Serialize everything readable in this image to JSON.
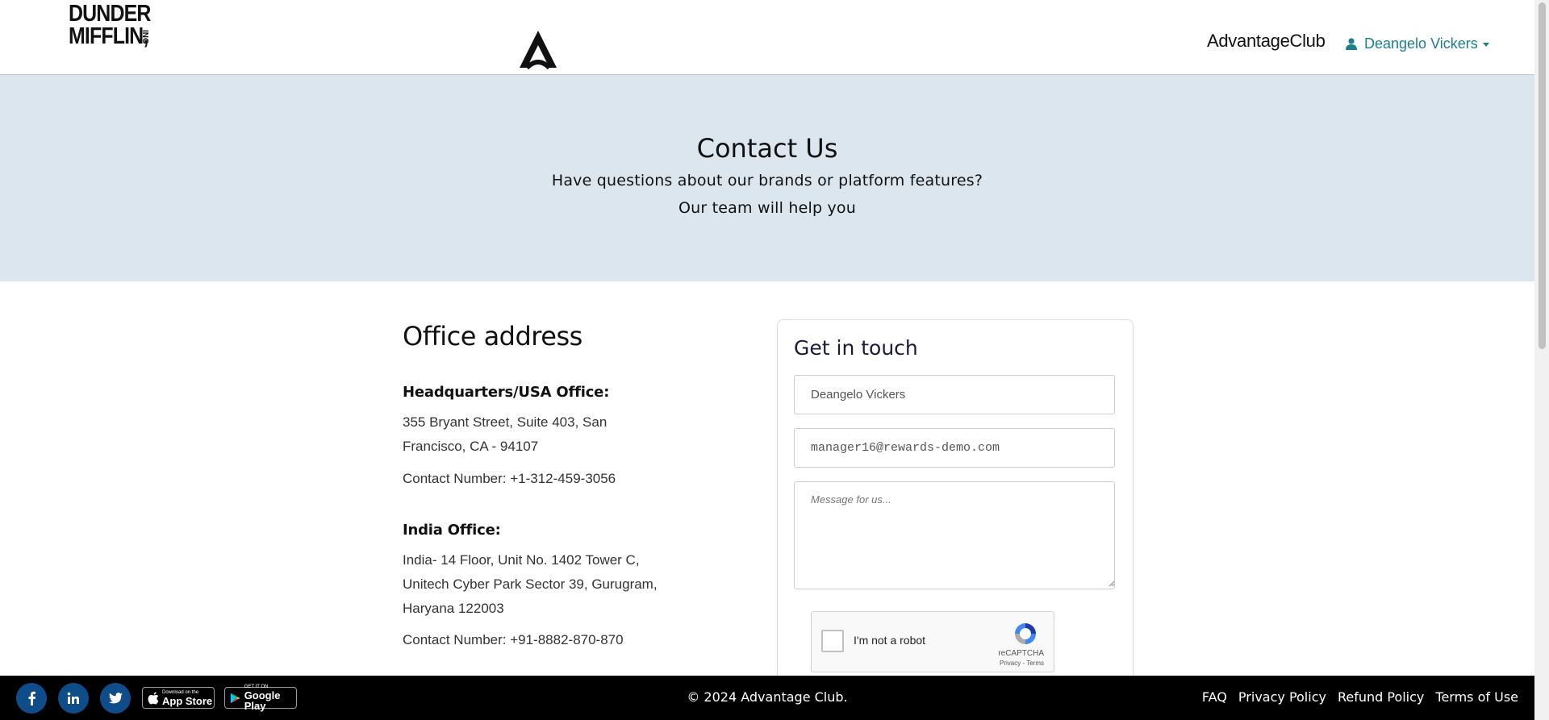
{
  "header": {
    "brand_line1": "DUNDER",
    "brand_line2": "MIFFLIN,",
    "brand_inc": "INC",
    "partner_brand": "AdvantageClub",
    "user_name": "Deangelo Vickers"
  },
  "hero": {
    "title": "Contact Us",
    "subtitle1": "Have questions about our brands or platform features?",
    "subtitle2": "Our team will help you",
    "bg_color": "#dbe6ef"
  },
  "office": {
    "title": "Office address",
    "hq_heading": "Headquarters/USA Office:",
    "hq_address": "355 Bryant Street, Suite 403, San Francisco, CA - 94107",
    "hq_contact": "Contact Number: +1-312-459-3056",
    "india_heading": "India Office:",
    "india_address": "India- 14 Floor, Unit No. 1402 Tower C, Unitech Cyber Park Sector 39, Gurugram, Haryana 122003",
    "india_contact": "Contact Number: +91-8882-870-870"
  },
  "form": {
    "title": "Get in touch",
    "name_value": "Deangelo Vickers",
    "email_value": "manager16@rewards-demo.com",
    "message_placeholder": "Message for us...",
    "captcha_label": "I'm not a robot",
    "captcha_brand": "reCAPTCHA",
    "captcha_links": "Privacy - Terms"
  },
  "footer": {
    "appstore_small": "Download on the",
    "appstore_big": "App Store",
    "googleplay_small": "GET IT ON",
    "googleplay_big": "Google Play",
    "copyright": "© 2024 Advantage Club.",
    "links": [
      "FAQ",
      "Privacy Policy",
      "Refund Policy",
      "Terms of Use"
    ],
    "social_color": "#0f4d8a"
  },
  "accent_color": "#1b7f8c"
}
